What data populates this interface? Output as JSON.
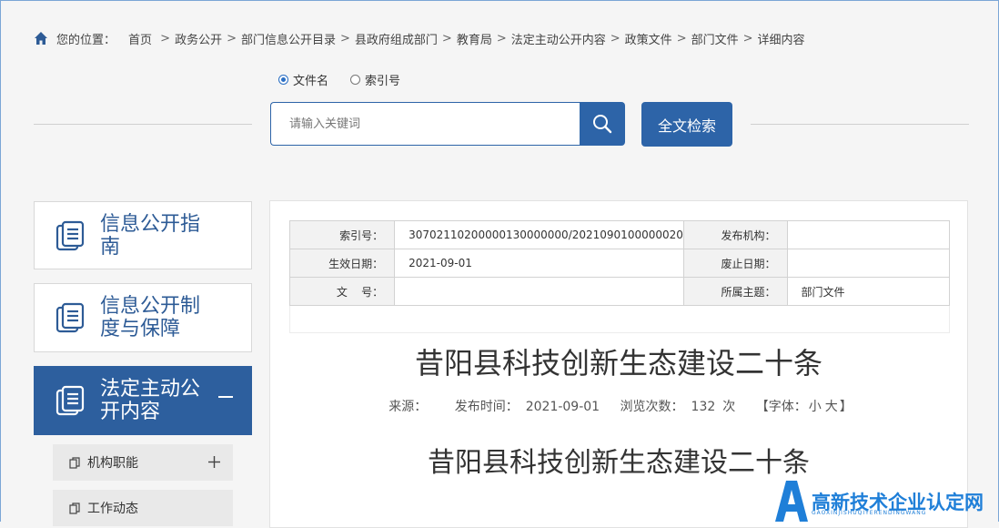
{
  "breadcrumb": {
    "prefix": "您的位置：",
    "items": [
      "首页",
      "政务公开",
      "部门信息公开目录",
      "县政府组成部门",
      "教育局",
      "法定主动公开内容",
      "政策文件",
      "部门文件",
      "详细内容"
    ]
  },
  "search": {
    "radio_options": [
      "文件名",
      "索引号"
    ],
    "selected": "文件名",
    "placeholder": "请输入关键词",
    "fulltext_button": "全文检索"
  },
  "sidebar": {
    "cards": [
      {
        "label": "信息公开指南",
        "active": false
      },
      {
        "label": "信息公开制度与保障",
        "active": false
      },
      {
        "label": "法定主动公开内容",
        "active": true
      }
    ],
    "sub_items": [
      "机构职能",
      "工作动态"
    ]
  },
  "meta": {
    "index_label": "索引号：",
    "index_value": "30702110200000130000000/2021090100000020",
    "publisher_label": "发布机构：",
    "publisher_value": "",
    "effective_label": "生效日期：",
    "effective_value": "2021-09-01",
    "expire_label": "废止日期：",
    "expire_value": "",
    "docno_label": "文    号：",
    "docno_value": "",
    "topic_label": "所属主题：",
    "topic_value": "部门文件"
  },
  "article": {
    "title": "昔阳县科技创新生态建设二十条",
    "source_label": "来源：",
    "source_value": "",
    "time_label": "发布时间：",
    "time_value": "2021-09-01",
    "views_label": "浏览次数：",
    "views_value": "132",
    "views_unit": "次",
    "font_label": "【字体：",
    "font_small": "小",
    "font_large": "大",
    "font_close": "】",
    "subtitle": "昔阳县科技创新生态建设二十条"
  },
  "watermark": {
    "text": "高新技术企业认定网",
    "sub": "GAOXINJISHUQIYERENDINGWANG"
  },
  "colors": {
    "primary": "#2d64a8",
    "sidebar_active": "#2d5f9e",
    "sidebar_text": "#2d5b96",
    "watermark": "#1f7fd8"
  }
}
